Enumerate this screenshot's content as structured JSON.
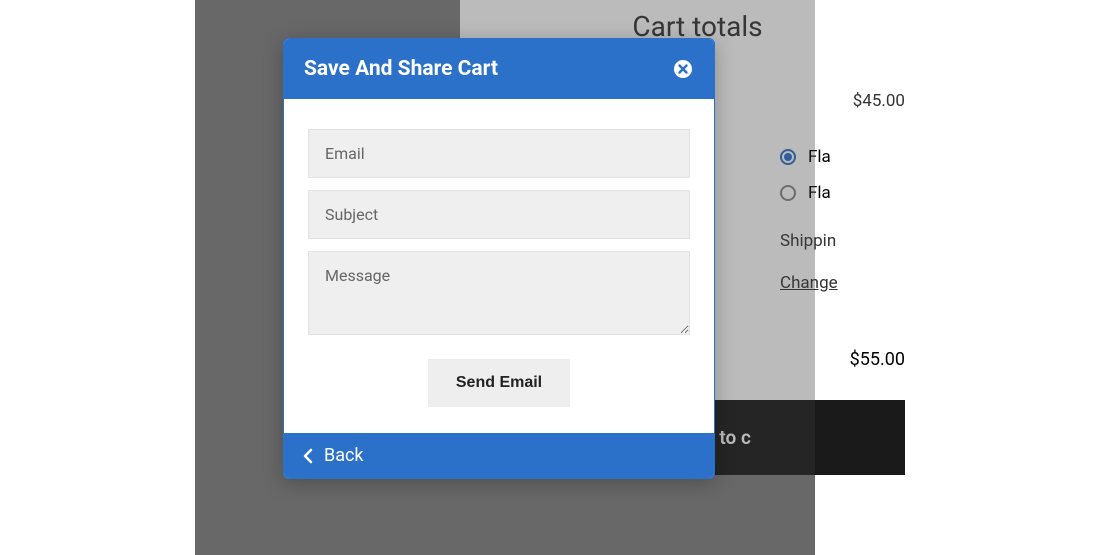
{
  "cart": {
    "title": "Cart totals",
    "subtotal": "$45.00",
    "shipping": {
      "options": [
        {
          "label": "Fla",
          "selected": true
        },
        {
          "label": "Fla",
          "selected": false
        }
      ],
      "to_label": "Shippin",
      "change_label": "Change"
    },
    "total": "$55.00",
    "checkout_label": "Proceed to c"
  },
  "modal": {
    "title": "Save And Share Cart",
    "fields": {
      "email_placeholder": "Email",
      "subject_placeholder": "Subject",
      "message_placeholder": "Message"
    },
    "send_label": "Send Email",
    "back_label": "Back"
  },
  "colors": {
    "primary": "#2b71c9",
    "dark": "#1a1a1a"
  }
}
